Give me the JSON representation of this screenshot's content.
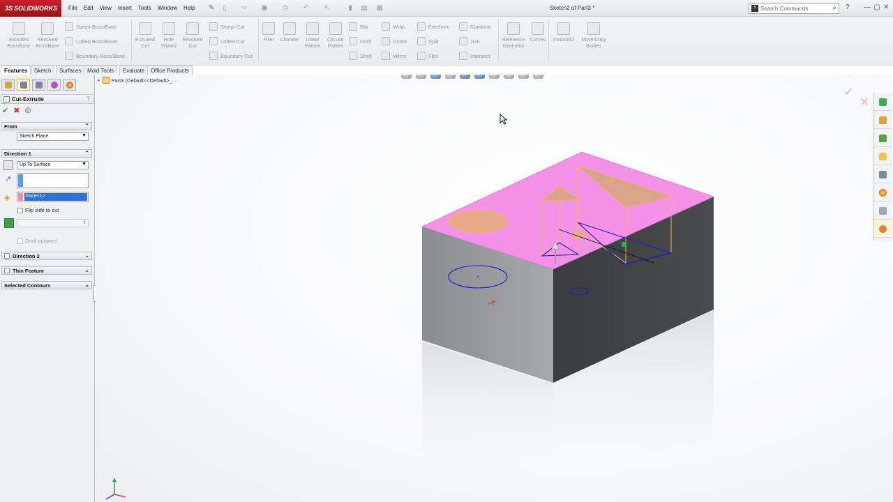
{
  "app": {
    "logo_text": "SOLIDWORKS",
    "doc_title": "Sketch2 of Part3 *"
  },
  "menu": [
    "File",
    "Edit",
    "View",
    "Insert",
    "Tools",
    "Window",
    "Help"
  ],
  "search": {
    "placeholder": "Search Commands"
  },
  "ribbon": {
    "extruded_boss": "Extruded Boss/Base",
    "revolved_boss": "Revolved Boss/Base",
    "swept_boss": "Swept Boss/Base",
    "lofted_boss": "Lofted Boss/Base",
    "boundary_boss": "Boundary Boss/Base",
    "extruded_cut": "Extruded Cut",
    "hole_wizard": "Hole Wizard",
    "revolved_cut": "Revolved Cut",
    "swept_cut": "Swept Cut",
    "lofted_cut": "Lofted Cut",
    "boundary_cut": "Boundary Cut",
    "fillet": "Fillet",
    "chamfer": "Chamfer",
    "linear_pattern": "Linear Pattern",
    "circular_pattern": "Circular Pattern",
    "rib": "Rib",
    "draft": "Draft",
    "shell": "Shell",
    "wrap": "Wrap",
    "dome": "Dome",
    "mirror": "Mirror",
    "freeform": "Freeform",
    "split": "Split",
    "flex": "Flex",
    "combine": "Combine",
    "join": "Join",
    "intersect": "Intersect",
    "reference_geometry": "Reference Geometry",
    "curves": "Curves",
    "instant3d": "Instant3D",
    "move_copy": "Move/Copy Bodies"
  },
  "tabs": [
    "Features",
    "Sketch",
    "Surfaces",
    "Mold Tools",
    "Evaluate",
    "Office Products"
  ],
  "property_manager": {
    "title": "Cut-Extrude",
    "help": "?",
    "from": {
      "header": "From",
      "value": "Sketch Plane"
    },
    "direction1": {
      "header": "Direction 1",
      "end_condition": "Up To Surface",
      "face": "Face<1>",
      "flip_side": "Flip side to cut",
      "draft_outward": "Draft outward"
    },
    "direction2": {
      "header": "Direction 2"
    },
    "thin_feature": {
      "header": "Thin Feature"
    },
    "selected_contours": {
      "header": "Selected Contours"
    }
  },
  "viewport": {
    "breadcrumb": "Part3  (Default<<Default>_..."
  }
}
